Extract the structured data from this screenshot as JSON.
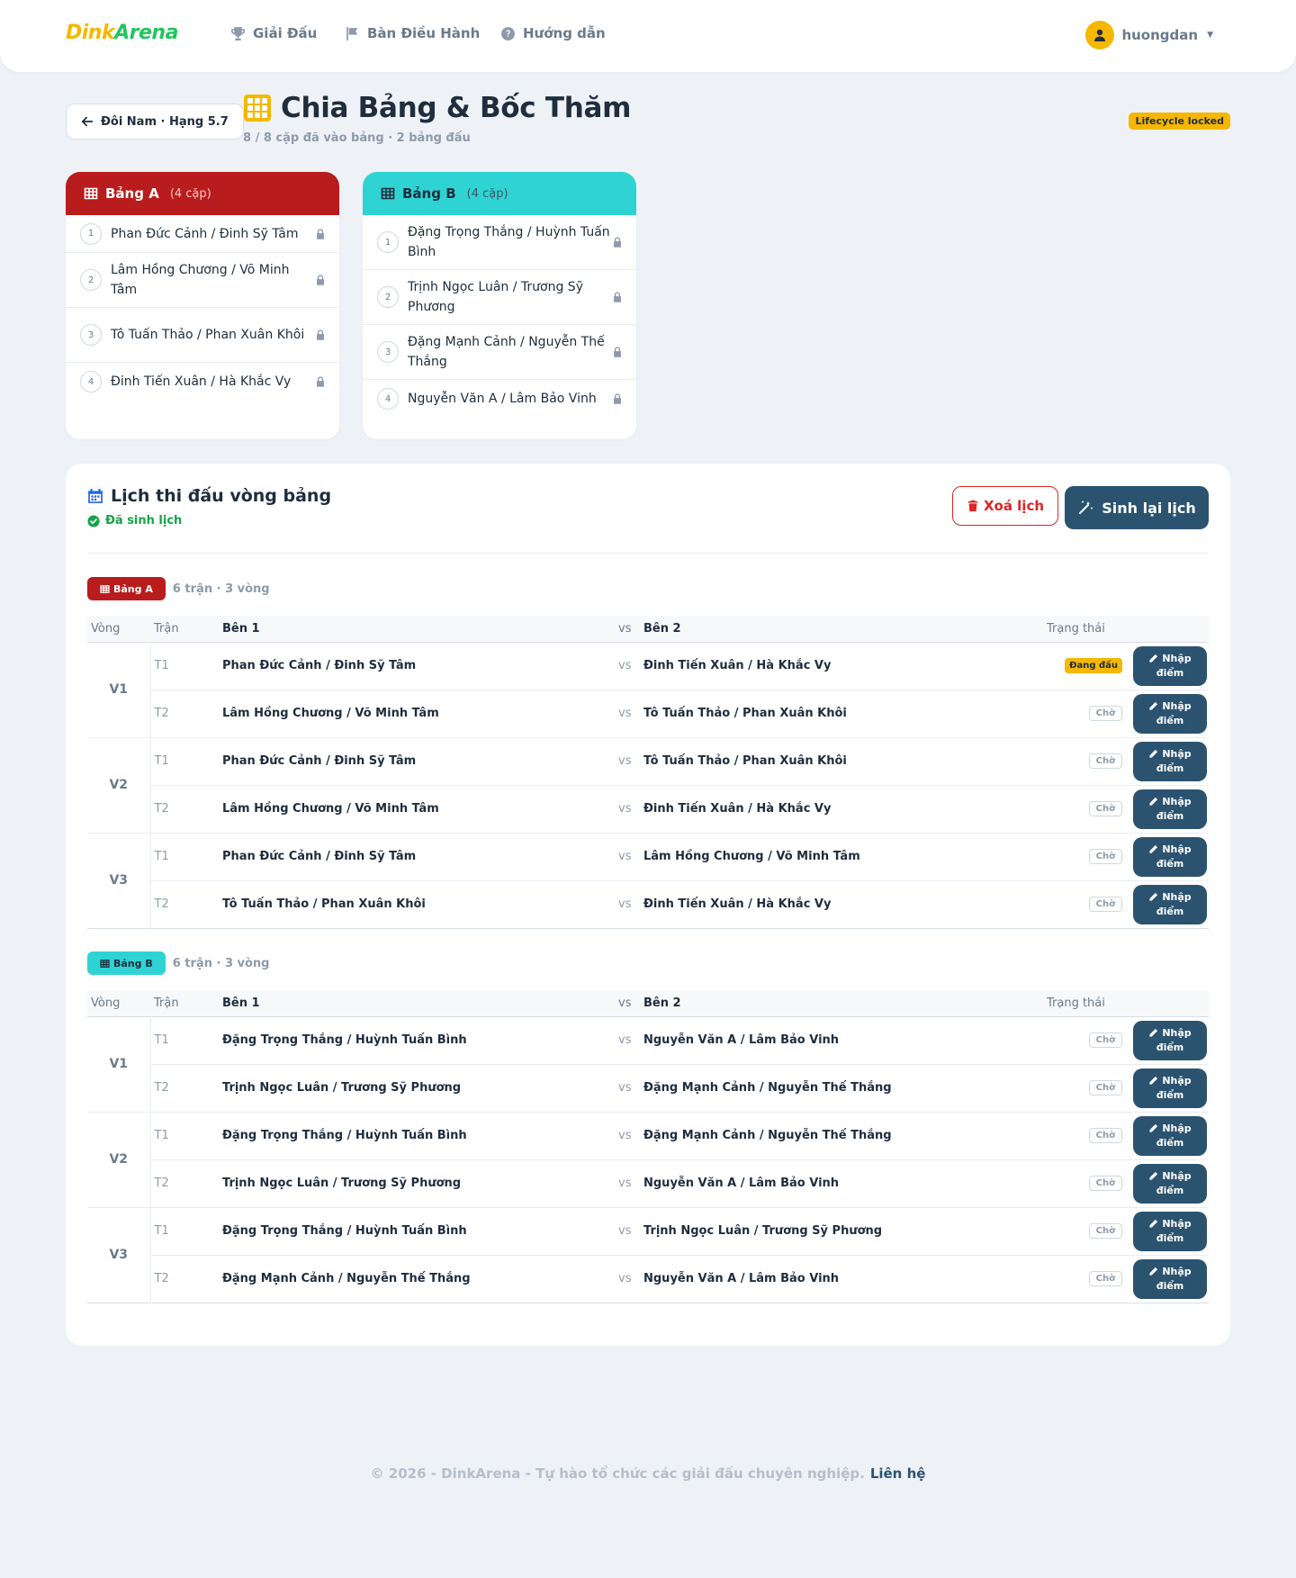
{
  "nav": {
    "logo_part1": "Dink",
    "logo_part2": "Arena",
    "items": [
      {
        "label": "Giải Đấu",
        "icon": "trophy-icon"
      },
      {
        "label": "Bàn Điều Hành",
        "icon": "flag-icon"
      },
      {
        "label": "Hướng dẫn",
        "icon": "question-circle-icon"
      }
    ],
    "username": "huongdan"
  },
  "header": {
    "back_label": "Đôi Nam · Hạng 5.7",
    "title": "Chia Bảng & Bốc Thăm",
    "subtitle": "8 / 8 cặp đã vào bảng  ·  2 bảng đấu",
    "badge": "Lifecycle locked"
  },
  "groups": [
    {
      "name": "Bảng A",
      "count": "(4 cặp)",
      "color": "#b91c1c",
      "pairs": [
        {
          "num": "1",
          "name": "Phan Đức Cảnh / Đinh Sỹ Tâm"
        },
        {
          "num": "2",
          "name": "Lâm Hồng Chương / Võ Minh Tâm"
        },
        {
          "num": "3",
          "name": "Tô Tuấn Thảo / Phan Xuân Khôi"
        },
        {
          "num": "4",
          "name": "Đinh Tiến Xuân / Hà Khắc Vy"
        }
      ]
    },
    {
      "name": "Bảng B",
      "count": "(4 cặp)",
      "color": "#2fd3d3",
      "pairs": [
        {
          "num": "1",
          "name": "Đặng Trọng Thắng / Huỳnh Tuấn Bình"
        },
        {
          "num": "2",
          "name": "Trịnh Ngọc Luân / Trương Sỹ Phương"
        },
        {
          "num": "3",
          "name": "Đặng Mạnh Cảnh / Nguyễn Thế Thắng"
        },
        {
          "num": "4",
          "name": "Nguyễn Văn A / Lâm Bảo Vinh"
        }
      ]
    }
  ],
  "schedule": {
    "title": "Lịch thi đấu vòng bảng",
    "status": "Đã sinh lịch",
    "delete_label": "Xoá lịch",
    "regen_label": "Sinh lại lịch",
    "columns": {
      "round": "Vòng",
      "match": "Trận",
      "side1": "Bên 1",
      "vs": "vs",
      "side2": "Bên 2",
      "status": "Trạng thái"
    },
    "score_btn_line1": "Nhập",
    "score_btn_line2": "điểm",
    "groups": [
      {
        "label": "Bảng A",
        "meta": "6 trận · 3 vòng",
        "rounds": [
          {
            "round": "V1",
            "matches": [
              {
                "code": "T1",
                "side1": "Phan Đức Cảnh / Đinh Sỹ Tâm",
                "side2": "Đinh Tiến Xuân / Hà Khắc Vy",
                "status": "Đang đấu",
                "status_type": "playing"
              },
              {
                "code": "T2",
                "side1": "Lâm Hồng Chương / Võ Minh Tâm",
                "side2": "Tô Tuấn Thảo / Phan Xuân Khôi",
                "status": "Chờ",
                "status_type": "waiting"
              }
            ]
          },
          {
            "round": "V2",
            "matches": [
              {
                "code": "T1",
                "side1": "Phan Đức Cảnh / Đinh Sỹ Tâm",
                "side2": "Tô Tuấn Thảo / Phan Xuân Khôi",
                "status": "Chờ",
                "status_type": "waiting"
              },
              {
                "code": "T2",
                "side1": "Lâm Hồng Chương / Võ Minh Tâm",
                "side2": "Đinh Tiến Xuân / Hà Khắc Vy",
                "status": "Chờ",
                "status_type": "waiting"
              }
            ]
          },
          {
            "round": "V3",
            "matches": [
              {
                "code": "T1",
                "side1": "Phan Đức Cảnh / Đinh Sỹ Tâm",
                "side2": "Lâm Hồng Chương / Võ Minh Tâm",
                "status": "Chờ",
                "status_type": "waiting"
              },
              {
                "code": "T2",
                "side1": "Tô Tuấn Thảo / Phan Xuân Khôi",
                "side2": "Đinh Tiến Xuân / Hà Khắc Vy",
                "status": "Chờ",
                "status_type": "waiting"
              }
            ]
          }
        ]
      },
      {
        "label": "Bảng B",
        "meta": "6 trận · 3 vòng",
        "rounds": [
          {
            "round": "V1",
            "matches": [
              {
                "code": "T1",
                "side1": "Đặng Trọng Thắng / Huỳnh Tuấn Bình",
                "side2": "Nguyễn Văn A / Lâm Bảo Vinh",
                "status": "Chờ",
                "status_type": "waiting"
              },
              {
                "code": "T2",
                "side1": "Trịnh Ngọc Luân / Trương Sỹ Phương",
                "side2": "Đặng Mạnh Cảnh / Nguyễn Thế Thắng",
                "status": "Chờ",
                "status_type": "waiting"
              }
            ]
          },
          {
            "round": "V2",
            "matches": [
              {
                "code": "T1",
                "side1": "Đặng Trọng Thắng / Huỳnh Tuấn Bình",
                "side2": "Đặng Mạnh Cảnh / Nguyễn Thế Thắng",
                "status": "Chờ",
                "status_type": "waiting"
              },
              {
                "code": "T2",
                "side1": "Trịnh Ngọc Luân / Trương Sỹ Phương",
                "side2": "Nguyễn Văn A / Lâm Bảo Vinh",
                "status": "Chờ",
                "status_type": "waiting"
              }
            ]
          },
          {
            "round": "V3",
            "matches": [
              {
                "code": "T1",
                "side1": "Đặng Trọng Thắng / Huỳnh Tuấn Bình",
                "side2": "Trịnh Ngọc Luân / Trương Sỹ Phương",
                "status": "Chờ",
                "status_type": "waiting"
              },
              {
                "code": "T2",
                "side1": "Đặng Mạnh Cảnh / Nguyễn Thế Thắng",
                "side2": "Nguyễn Văn A / Lâm Bảo Vinh",
                "status": "Chờ",
                "status_type": "waiting"
              }
            ]
          }
        ]
      }
    ]
  },
  "footer": {
    "text": "© 2026 - DinkArena - Tự hào tổ chức các giải đấu chuyên nghiệp.",
    "link": "Liên hệ"
  }
}
